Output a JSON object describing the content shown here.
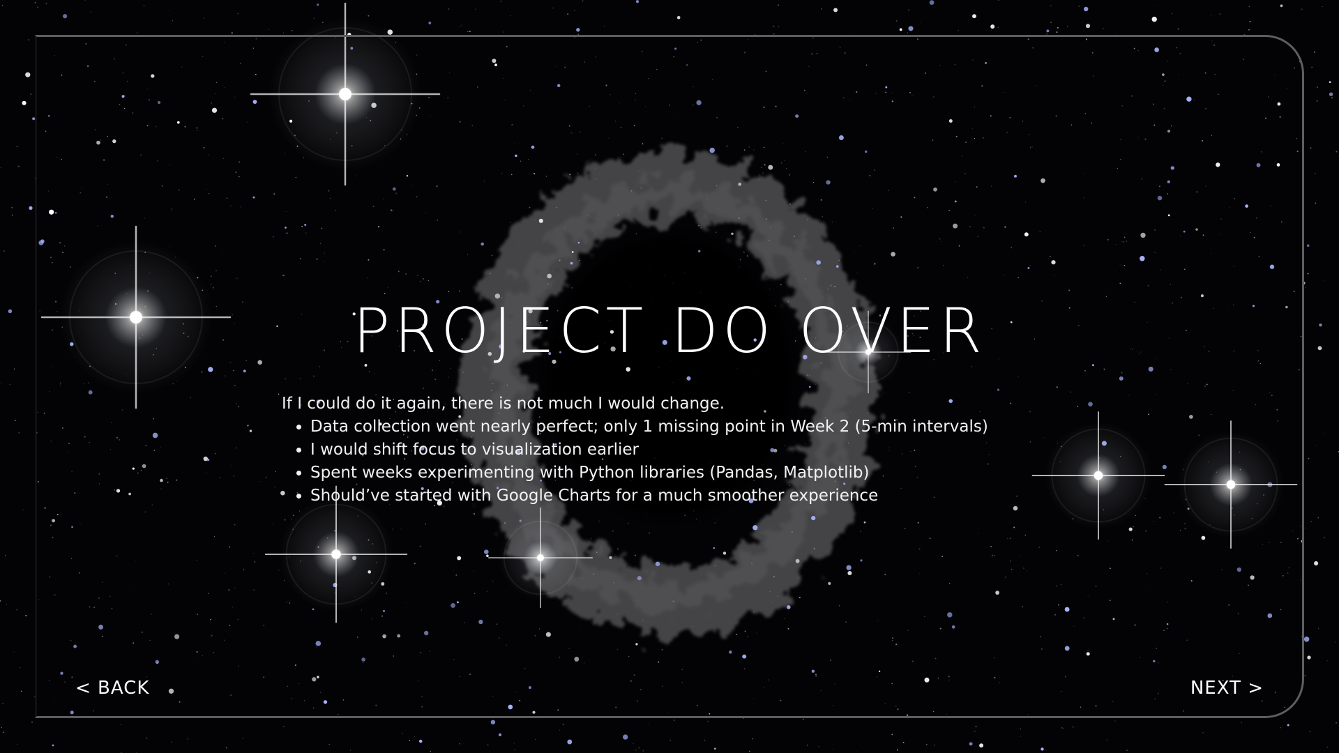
{
  "slide": {
    "title": "PROJECT DO OVER",
    "intro": "If I could do it again, there is not much I would change.",
    "bullets": [
      "Data collection went nearly perfect; only 1 missing point in Week 2 (5-min intervals)",
      "I would shift focus to visualization earlier",
      "Spent weeks experimenting with Python libraries (Pandas, Matplotlib)",
      "Should’ve started with Google Charts for a much smoother experience"
    ]
  },
  "navigation": {
    "back_label": "< BACK",
    "next_label": "NEXT >"
  },
  "colors": {
    "background": "#030305",
    "text": "#ffffff",
    "frame": "#5e5e60",
    "star_tint": "#a9b4ff"
  }
}
